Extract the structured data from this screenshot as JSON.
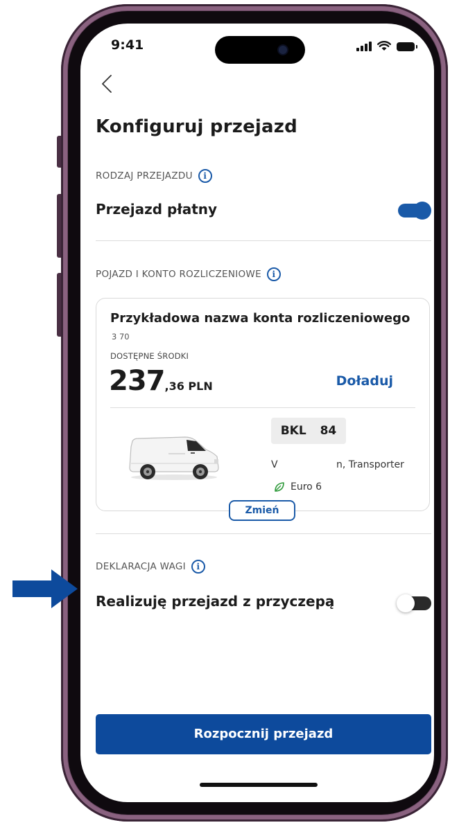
{
  "status_bar": {
    "time": "9:41"
  },
  "header": {
    "title": "Konfiguruj przejazd"
  },
  "trip_type": {
    "section_label": "RODZAJ PRZEJAZDU",
    "option_label": "Przejazd płatny",
    "toggle_on": true
  },
  "vehicle_account": {
    "section_label": "POJAZD I KONTO ROZLICZENIOWE",
    "account_name": "Przykładowa nazwa konta rozliczeniowego",
    "account_number": "3   70",
    "funds_label": "DOSTĘPNE ŚRODKI",
    "amount_whole": "237",
    "amount_rest": ",36 PLN",
    "topup_label": "Doładuj",
    "plate": "BKL 84",
    "vehicle_make": "V",
    "vehicle_model": "n, Transporter",
    "emission": "Euro 6",
    "change_label": "Zmień"
  },
  "weight": {
    "section_label": "DEKLARACJA WAGI",
    "option_label": "Realizuję przejazd z przyczepą",
    "toggle_on": false
  },
  "start_button_label": "Rozpocznij przejazd",
  "colors": {
    "accent": "#1a5aa8",
    "primary_button": "#0d4a9c",
    "frame": "#6e4a66",
    "leaf": "#2e9a3a"
  }
}
